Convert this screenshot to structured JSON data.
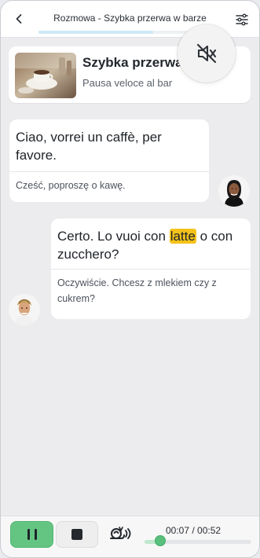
{
  "header": {
    "title": "Rozmowa - Szybka przerwa w barze",
    "progress": 0.63
  },
  "scene": {
    "title": "Szybka przerwa w",
    "subtitle": "Pausa veloce al bar"
  },
  "messages": [
    {
      "main": "Ciao, vorrei un caffè, per favore.",
      "translation": "Cześć, poproszę o kawę."
    },
    {
      "main_prefix": "Certo. Lo vuoi con ",
      "highlight": "latte",
      "main_suffix": " o con zucchero?",
      "translation": "Oczywiście. Chcesz z mlekiem czy z cukrem?"
    }
  ],
  "controls": {
    "time": "00:07 / 00:52",
    "progress": 0.14
  },
  "icons": {
    "back": "chevron-left-icon",
    "settings": "sliders-icon",
    "mute": "speaker-muted-icon",
    "pause": "pause-icon",
    "stop": "stop-icon",
    "slow": "snail-icon"
  }
}
